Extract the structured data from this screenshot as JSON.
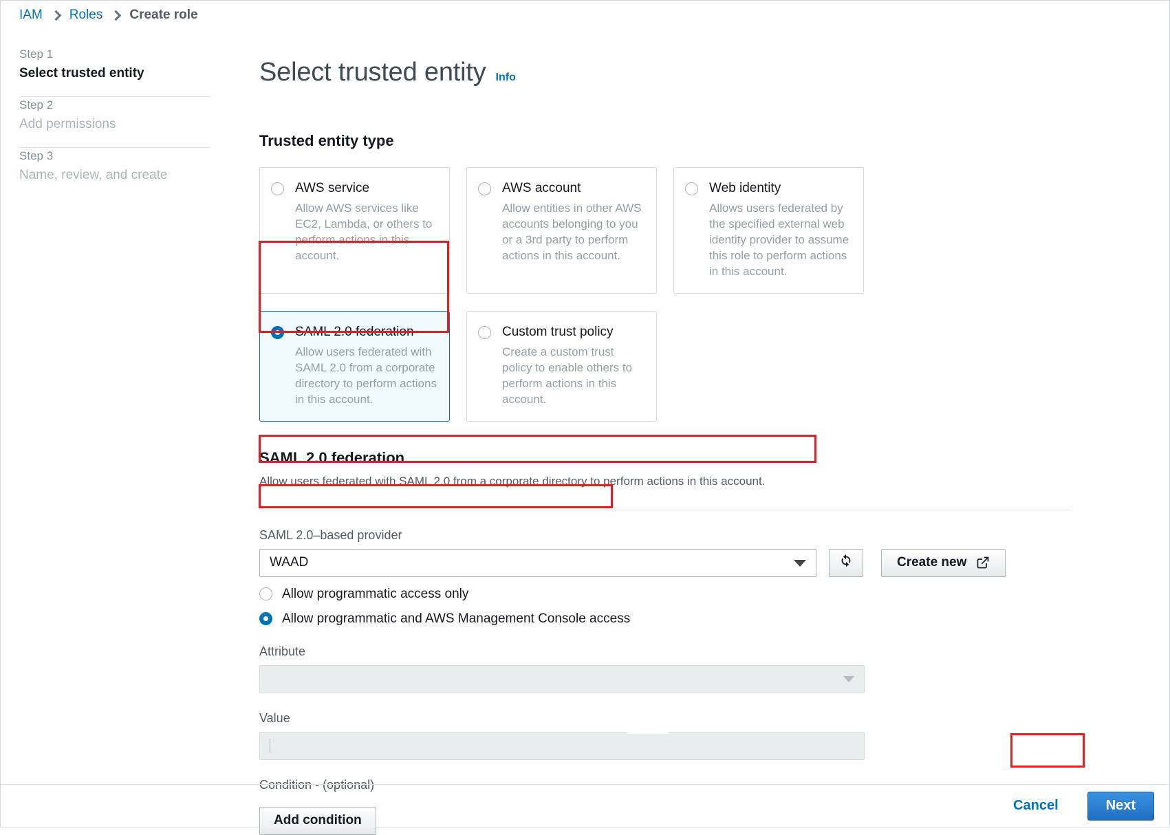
{
  "breadcrumb": {
    "items": [
      {
        "label": "IAM",
        "current": false
      },
      {
        "label": "Roles",
        "current": false
      },
      {
        "label": "Create role",
        "current": true
      }
    ]
  },
  "steps": [
    {
      "number": "Step 1",
      "name": "Select trusted entity",
      "state": "active"
    },
    {
      "number": "Step 2",
      "name": "Add permissions",
      "state": "inactive"
    },
    {
      "number": "Step 3",
      "name": "Name, review, and create",
      "state": "inactive"
    }
  ],
  "header": {
    "title": "Select trusted entity",
    "info_label": "Info"
  },
  "trusted_entity_type": {
    "heading": "Trusted entity type",
    "options": [
      {
        "title": "AWS service",
        "description": "Allow AWS services like EC2, Lambda, or others to perform actions in this account.",
        "selected": false
      },
      {
        "title": "AWS account",
        "description": "Allow entities in other AWS accounts belonging to you or a 3rd party to perform actions in this account.",
        "selected": false
      },
      {
        "title": "Web identity",
        "description": "Allows users federated by the specified external web identity provider to assume this role to perform actions in this account.",
        "selected": false
      },
      {
        "title": "SAML 2.0 federation",
        "description": "Allow users federated with SAML 2.0 from a corporate directory to perform actions in this account.",
        "selected": true
      },
      {
        "title": "Custom trust policy",
        "description": "Create a custom trust policy to enable others to perform actions in this account.",
        "selected": false
      }
    ]
  },
  "saml_section": {
    "heading": "SAML 2.0 federation",
    "description": "Allow users federated with SAML 2.0 from a corporate directory to perform actions in this account.",
    "provider": {
      "label": "SAML 2.0–based provider",
      "value": "WAAD",
      "refresh_icon": "refresh-icon",
      "create_new_label": "Create new",
      "create_new_icon": "external-link-icon"
    },
    "access_options": [
      {
        "label": "Allow programmatic access only",
        "selected": false
      },
      {
        "label": "Allow programmatic and AWS Management Console access",
        "selected": true
      }
    ],
    "attribute": {
      "label": "Attribute",
      "value": "",
      "disabled": true
    },
    "value_field": {
      "label": "Value",
      "value": "",
      "disabled": true
    },
    "condition": {
      "label": "Condition - (optional)",
      "add_button_label": "Add condition"
    }
  },
  "footer": {
    "cancel_label": "Cancel",
    "next_label": "Next"
  },
  "colors": {
    "link": "#0073bb",
    "selected_tile_bg": "#f1faff",
    "annotation": "#e81b23",
    "primary_button": "#2a7fd0"
  }
}
